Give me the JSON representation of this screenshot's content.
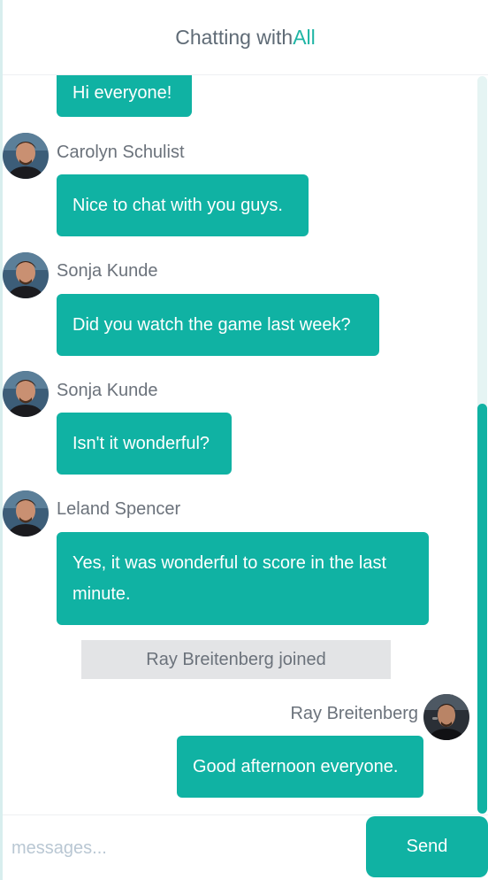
{
  "header": {
    "prefix": "Chatting with",
    "target": "All"
  },
  "messages": [
    {
      "sender": "",
      "text": "Hi everyone!"
    },
    {
      "sender": "Carolyn Schulist",
      "text": "Nice to chat with you guys."
    },
    {
      "sender": "Sonja Kunde",
      "text": "Did you watch the game last week?"
    },
    {
      "sender": "Sonja Kunde",
      "text": "Isn't it wonderful?"
    },
    {
      "sender": "Leland Spencer",
      "text": "Yes, it was wonderful to score in the last minute."
    },
    {
      "sender": "Ray Breitenberg",
      "text": "Good afternoon everyone."
    }
  ],
  "system_notice": "Ray Breitenberg joined",
  "composer": {
    "placeholder": "messages...",
    "send_label": "Send"
  },
  "colors": {
    "accent": "#10b2a3",
    "header_accent": "#1fb5a5",
    "system_bg": "#e3e4e6"
  }
}
